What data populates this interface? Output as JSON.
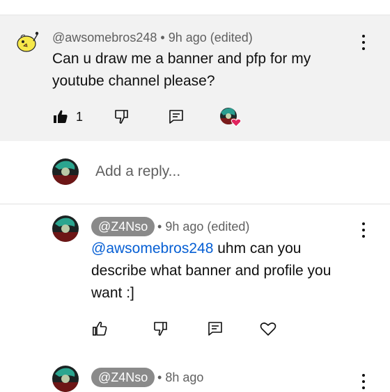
{
  "comment": {
    "author": "@awsomebros248",
    "meta": "9h ago (edited)",
    "text_line1": "Can u draw me a banner and pfp for my",
    "text_line2": "youtube channel please?",
    "like_count": "1"
  },
  "reply_box": {
    "placeholder": "Add a reply..."
  },
  "reply1": {
    "author": "@Z4Nso",
    "meta": "9h ago (edited)",
    "mention": "@awsomebros248",
    "text_line1_rest": " uhm can you",
    "text_line2": "describe what banner and profile you",
    "text_line3": "want :]"
  },
  "reply2": {
    "author": "@Z4Nso",
    "meta": "8h ago"
  },
  "colors": {
    "accent_link": "#065fd4",
    "heart": "#e0245e",
    "pill_bg": "#8a8a8a"
  }
}
